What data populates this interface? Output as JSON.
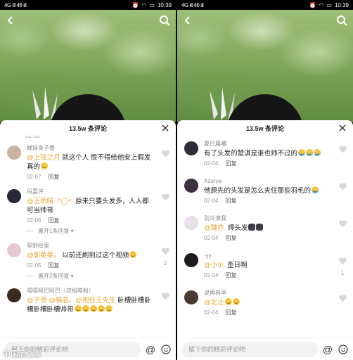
{
  "status": {
    "time": "10:39",
    "signal": "4G ıll 46 ıll"
  },
  "left": {
    "header_title": "13.5w 条评论",
    "partial_meta": "02-03",
    "comments": [
      {
        "user": "婵妹身子香",
        "text_parts": [
          {
            "t": "@上弦之月",
            "mention": true
          },
          {
            "t": " 就这个人 恨不得给他安上假发真的",
            "mention": false
          }
        ],
        "date": "02-07",
        "reply": "回复",
        "likes": "",
        "avatar": "#c9b3a0"
      },
      {
        "user": "段嘉许",
        "text_parts": [
          {
            "t": "@王雨晴 ·^◯^·",
            "mention": true
          },
          {
            "t": " 原来只要头发多，人人都可当帅哥",
            "mention": false
          }
        ],
        "date": "02-06",
        "reply": "回复",
        "likes": "",
        "avatar": "#2a2838",
        "expand": "展开1条回复"
      },
      {
        "user": "星野绘里",
        "text_parts": [
          {
            "t": "@郭菜菜。",
            "mention": true
          },
          {
            "t": " 以前还刷到过这个视频",
            "mention": false
          }
        ],
        "date": "02-05",
        "reply": "回复",
        "likes": "1",
        "avatar": "#e8c8d0",
        "expand": "展开2条回复"
      },
      {
        "user": "嘻嘻阿巴阿巴（双担唯粉）",
        "text_parts": [
          {
            "t": "@子羡 @猫苾。@抱住王先生",
            "mention": true
          },
          {
            "t": " 卧槽卧槽卧槽卧槽卧槽帅哥",
            "mention": false
          }
        ],
        "date": "",
        "reply": "",
        "likes": "",
        "avatar": "#3a2a20"
      }
    ],
    "input_placeholder": "留下你的精彩评论吧",
    "watermark": "中国品之家"
  },
  "right": {
    "header_title": "13.5w 条评论",
    "comments": [
      {
        "user": "夏日晨曦",
        "text_parts": [
          {
            "t": "有了头发的楚淇是谁也帅不过的",
            "mention": false
          }
        ],
        "date": "02-04",
        "reply": "回复",
        "likes": "",
        "avatar": "#2c2c34"
      },
      {
        "user": "Azurya",
        "text_parts": [
          {
            "t": "他原先的头发是怎么夹住那些羽毛的",
            "mention": false
          }
        ],
        "date": "02-04",
        "reply": "回复",
        "likes": "",
        "avatar": "#3b3040"
      },
      {
        "user": "别冷漠我",
        "text_parts": [
          {
            "t": "@魏亦.",
            "mention": true
          },
          {
            "t": " 焊头发",
            "mention": false
          }
        ],
        "date": "02-04",
        "reply": "回复",
        "likes": "",
        "avatar": "#e8e0e8"
      },
      {
        "user": "-yy",
        "text_parts": [
          {
            "t": "@小①.",
            "mention": true
          },
          {
            "t": " 歪日啊",
            "mention": false
          }
        ],
        "date": "02-04",
        "reply": "回复",
        "likes": "1",
        "avatar": "#1e1a1c"
      },
      {
        "user": "说再冉早",
        "text_parts": [
          {
            "t": "@北止",
            "mention": true
          }
        ],
        "date": "02-04",
        "reply": "回复",
        "likes": "",
        "avatar": "#4a3a32"
      }
    ],
    "input_placeholder": "留下你的精彩评论吧"
  }
}
